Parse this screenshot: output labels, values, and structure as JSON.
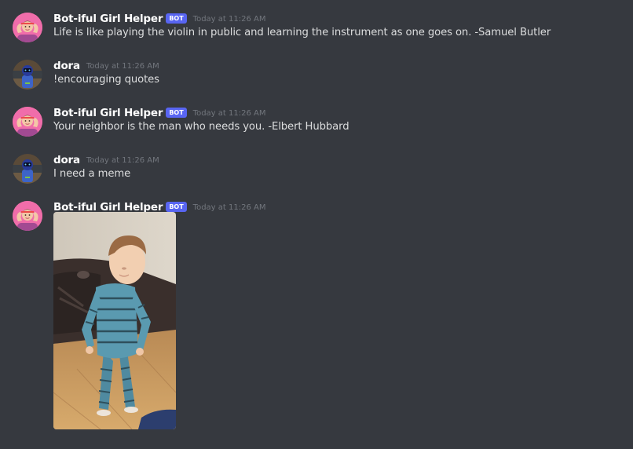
{
  "colors": {
    "background": "#36393f",
    "username": "#ffffff",
    "message_text": "#dcddde",
    "timestamp": "#72767d",
    "bot_badge": "#5865f2"
  },
  "messages": [
    {
      "author": "Bot-iful Girl Helper",
      "bot_badge": "BOT",
      "timestamp": "Today at 11:26 AM",
      "text": "Life is like playing the violin in public and learning the instrument as one goes on. -Samuel Butler",
      "avatar_icon": "flexing-girl-avatar"
    },
    {
      "author": "dora",
      "timestamp": "Today at 11:26 AM",
      "text": "!encouraging quotes",
      "avatar_icon": "blue-figure-avatar"
    },
    {
      "author": "Bot-iful Girl Helper",
      "bot_badge": "BOT",
      "timestamp": "Today at 11:26 AM",
      "text": "Your neighbor is the man who needs you. -Elbert Hubbard",
      "avatar_icon": "flexing-girl-avatar"
    },
    {
      "author": "dora",
      "timestamp": "Today at 11:26 AM",
      "text": "I need a meme",
      "avatar_icon": "blue-figure-avatar"
    },
    {
      "author": "Bot-iful Girl Helper",
      "bot_badge": "BOT",
      "timestamp": "Today at 11:26 AM",
      "avatar_icon": "flexing-girl-avatar",
      "attachment": {
        "type": "image",
        "subject": "toddler-dancing-meme"
      }
    }
  ]
}
